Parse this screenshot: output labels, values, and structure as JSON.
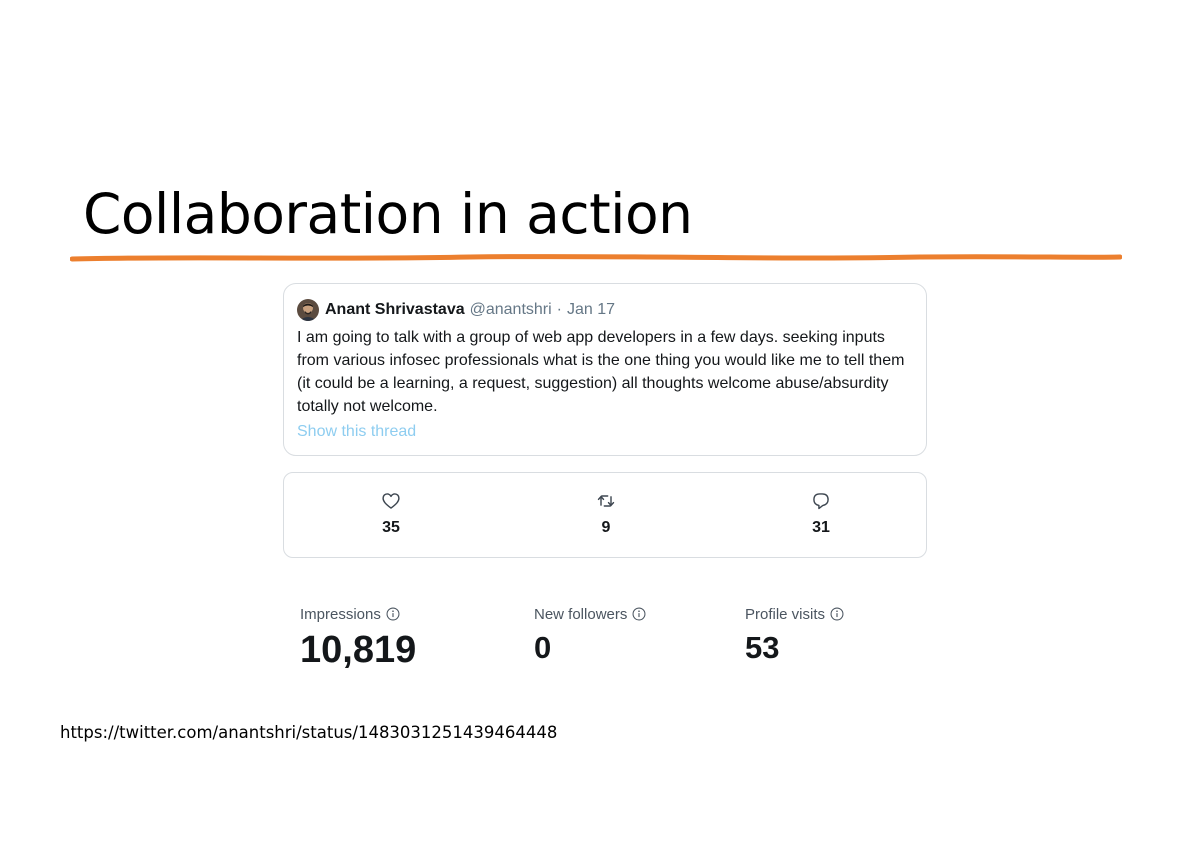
{
  "slide": {
    "title": "Collaboration in action",
    "underline_color": "#ec7f2e",
    "source_url": "https://twitter.com/anantshri/status/1483031251439464448"
  },
  "tweet": {
    "author_name": "Anant Shrivastava",
    "handle": "@anantshri",
    "separator": "·",
    "date": "Jan 17",
    "text": "I am going to talk with a group of web app developers in a few days. seeking inputs from various infosec professionals what is the one thing you would like me to tell them (it could be a learning, a request, suggestion) all thoughts welcome abuse/absurdity totally not welcome.",
    "show_thread": "Show this thread",
    "link_color": "#8ecdf0"
  },
  "engagement": {
    "likes": {
      "icon": "heart-icon",
      "count": "35"
    },
    "retweets": {
      "icon": "retweet-icon",
      "count": "9"
    },
    "replies": {
      "icon": "reply-icon",
      "count": "31"
    }
  },
  "stats": {
    "impressions": {
      "label": "Impressions",
      "value": "10,819",
      "icon": "info-icon"
    },
    "new_followers": {
      "label": "New followers",
      "value": "0",
      "icon": "info-icon"
    },
    "profile_visits": {
      "label": "Profile visits",
      "value": "53",
      "icon": "info-icon"
    }
  }
}
